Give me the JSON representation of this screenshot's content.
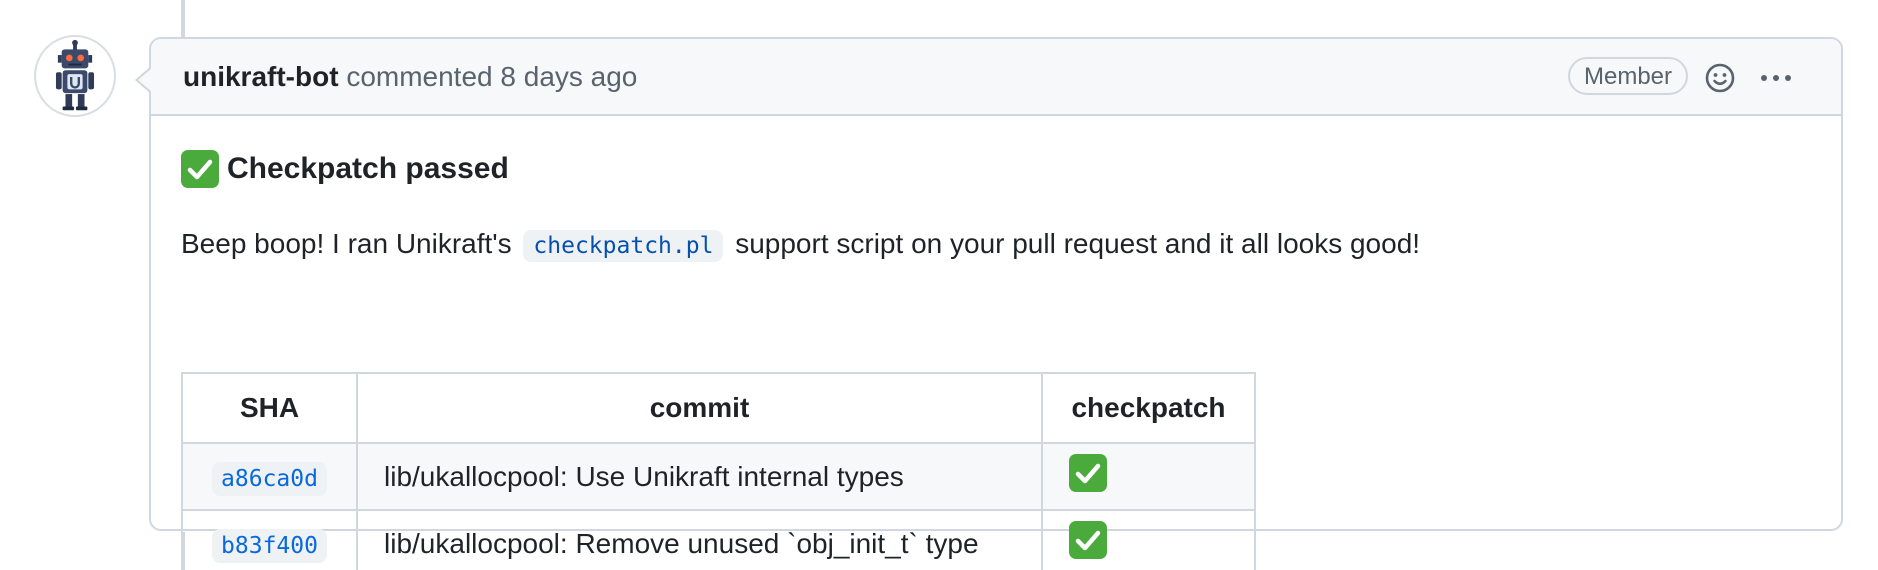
{
  "comment": {
    "author": "unikraft-bot",
    "action": "commented",
    "time": "8 days ago",
    "badge": "Member"
  },
  "icons": {
    "avatar": "robot-avatar-icon",
    "reaction": "smiley-icon",
    "more": "kebab-icon",
    "status": "check-mark-button-emoji"
  },
  "body": {
    "heading": "Checkpatch passed",
    "paragraph_before": "Beep boop! I ran Unikraft's",
    "code": "checkpatch.pl",
    "paragraph_after": "support script on your pull request and it all looks good!"
  },
  "table": {
    "headers": [
      "SHA",
      "commit",
      "checkpatch"
    ],
    "rows": [
      {
        "sha": "a86ca0d",
        "commit": "lib/ukallocpool: Use Unikraft internal types",
        "status": "passed"
      },
      {
        "sha": "b83f400",
        "commit": "lib/ukallocpool: Remove unused `obj_init_t` type",
        "status": "passed"
      }
    ]
  },
  "colors": {
    "border": "#d0d7de",
    "header_bg": "#f6f8fa",
    "link": "#0969da",
    "check_green": "#4aaa3c"
  }
}
